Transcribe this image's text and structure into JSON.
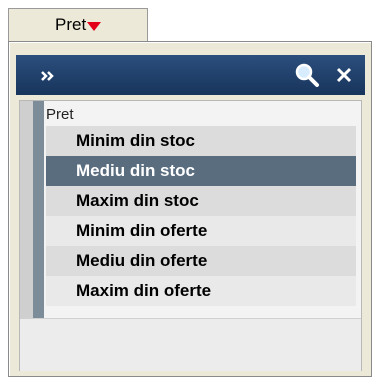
{
  "column_header": {
    "label": "Pret",
    "sort_icon": "red-triangle-down"
  },
  "popup": {
    "toolbar": {
      "expand_icon": "double-chevron-right",
      "search_icon": "magnifier",
      "close_icon": "x"
    },
    "list": {
      "header": "Pret",
      "items": [
        {
          "label": "Minim din stoc",
          "selected": false
        },
        {
          "label": "Mediu din stoc",
          "selected": true
        },
        {
          "label": "Maxim din stoc",
          "selected": false
        },
        {
          "label": "Minim din oferte",
          "selected": false
        },
        {
          "label": "Mediu din oferte",
          "selected": false
        },
        {
          "label": "Maxim din oferte",
          "selected": false
        }
      ]
    }
  },
  "colors": {
    "toolbar": "#1f3e69",
    "selected_row": "#5a6d7f",
    "sort_arrow": "#e3001b"
  }
}
